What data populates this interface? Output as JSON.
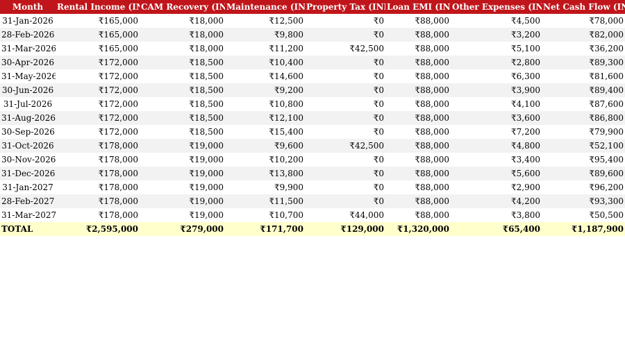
{
  "table": {
    "headers": [
      "Month",
      "Rental Income (INR)",
      "CAM Recovery (INR)",
      "Maintenance (INR)",
      "Property Tax (INR)",
      "Loan EMI (INR)",
      "Other Expenses (INR)",
      "Net Cash Flow (INR)"
    ],
    "rows": [
      [
        "31-Jan-2026",
        "₹165,000",
        "₹18,000",
        "₹12,500",
        "₹0",
        "₹88,000",
        "₹4,500",
        "₹78,000"
      ],
      [
        "28-Feb-2026",
        "₹165,000",
        "₹18,000",
        "₹9,800",
        "₹0",
        "₹88,000",
        "₹3,200",
        "₹82,000"
      ],
      [
        "31-Mar-2026",
        "₹165,000",
        "₹18,000",
        "₹11,200",
        "₹42,500",
        "₹88,000",
        "₹5,100",
        "₹36,200"
      ],
      [
        "30-Apr-2026",
        "₹172,000",
        "₹18,500",
        "₹10,400",
        "₹0",
        "₹88,000",
        "₹2,800",
        "₹89,300"
      ],
      [
        "31-May-2026",
        "₹172,000",
        "₹18,500",
        "₹14,600",
        "₹0",
        "₹88,000",
        "₹6,300",
        "₹81,600"
      ],
      [
        "30-Jun-2026",
        "₹172,000",
        "₹18,500",
        "₹9,200",
        "₹0",
        "₹88,000",
        "₹3,900",
        "₹89,400"
      ],
      [
        "31-Jul-2026",
        "₹172,000",
        "₹18,500",
        "₹10,800",
        "₹0",
        "₹88,000",
        "₹4,100",
        "₹87,600"
      ],
      [
        "31-Aug-2026",
        "₹172,000",
        "₹18,500",
        "₹12,100",
        "₹0",
        "₹88,000",
        "₹3,600",
        "₹86,800"
      ],
      [
        "30-Sep-2026",
        "₹172,000",
        "₹18,500",
        "₹15,400",
        "₹0",
        "₹88,000",
        "₹7,200",
        "₹79,900"
      ],
      [
        "31-Oct-2026",
        "₹178,000",
        "₹19,000",
        "₹9,600",
        "₹42,500",
        "₹88,000",
        "₹4,800",
        "₹52,100"
      ],
      [
        "30-Nov-2026",
        "₹178,000",
        "₹19,000",
        "₹10,200",
        "₹0",
        "₹88,000",
        "₹3,400",
        "₹95,400"
      ],
      [
        "31-Dec-2026",
        "₹178,000",
        "₹19,000",
        "₹13,800",
        "₹0",
        "₹88,000",
        "₹5,600",
        "₹89,600"
      ],
      [
        "31-Jan-2027",
        "₹178,000",
        "₹19,000",
        "₹9,900",
        "₹0",
        "₹88,000",
        "₹2,900",
        "₹96,200"
      ],
      [
        "28-Feb-2027",
        "₹178,000",
        "₹19,000",
        "₹11,500",
        "₹0",
        "₹88,000",
        "₹4,200",
        "₹93,300"
      ],
      [
        "31-Mar-2027",
        "₹178,000",
        "₹19,000",
        "₹10,700",
        "₹44,000",
        "₹88,000",
        "₹3,800",
        "₹50,500"
      ]
    ],
    "total": [
      "TOTAL",
      "₹2,595,000",
      "₹279,000",
      "₹171,700",
      "₹129,000",
      "₹1,320,000",
      "₹65,400",
      "₹1,187,900"
    ],
    "colors": {
      "header_bg": "#c0161b",
      "header_text": "#ffffff",
      "stripe_bg": "#f2f2f2",
      "total_bg": "#ffffcc"
    }
  }
}
